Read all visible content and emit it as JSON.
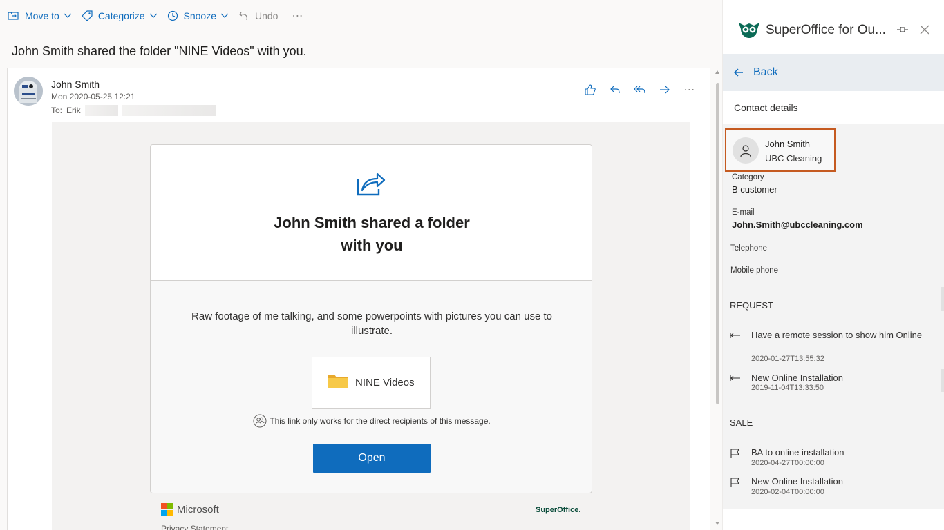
{
  "toolbar": {
    "move_to": "Move to",
    "categorize": "Categorize",
    "snooze": "Snooze",
    "undo": "Undo",
    "more": "⋯"
  },
  "subject": "John Smith shared the folder \"NINE Videos\" with you.",
  "message": {
    "sender_name": "John Smith",
    "date": "Mon 2020-05-25 12:21",
    "to_label": "To:",
    "to_name": "Erik",
    "actions_more": "⋯"
  },
  "share_card": {
    "title_line1": "John Smith shared a folder",
    "title_line2": "with you",
    "description": "Raw footage of me talking, and some powerpoints with pictures you can use to illustrate.",
    "folder_name": "NINE Videos",
    "link_note": "This link only works for the direct recipients of this message.",
    "open_label": "Open",
    "microsoft_label": "Microsoft",
    "superoffice_label": "SuperOffice.",
    "privacy_label": "Privacy Statement"
  },
  "addin": {
    "title": "SuperOffice for Ou...",
    "back_label": "Back",
    "section_title": "Contact details",
    "contact": {
      "name": "John Smith",
      "company": "UBC Cleaning"
    },
    "category_label": "Category",
    "category_value": "B customer",
    "email_label": "E-mail",
    "email_value": "John.Smith@ubccleaning.com",
    "telephone_label": "Telephone",
    "mobile_label": "Mobile phone",
    "request_title": "REQUEST",
    "requests": [
      {
        "text": "Have a remote session to show him Online",
        "date": "2020-01-27T13:55:32"
      },
      {
        "text": "New Online Installation",
        "date": "2019-11-04T13:33:50"
      }
    ],
    "sale_title": "SALE",
    "sales": [
      {
        "text": "BA to online installation",
        "date": "2020-04-27T00:00:00"
      },
      {
        "text": "New Online Installation",
        "date": "2020-02-04T00:00:00"
      }
    ]
  },
  "colors": {
    "accent": "#0f6cbd",
    "highlight_border": "#c55a20",
    "folder_yellow": "#f7c948"
  }
}
